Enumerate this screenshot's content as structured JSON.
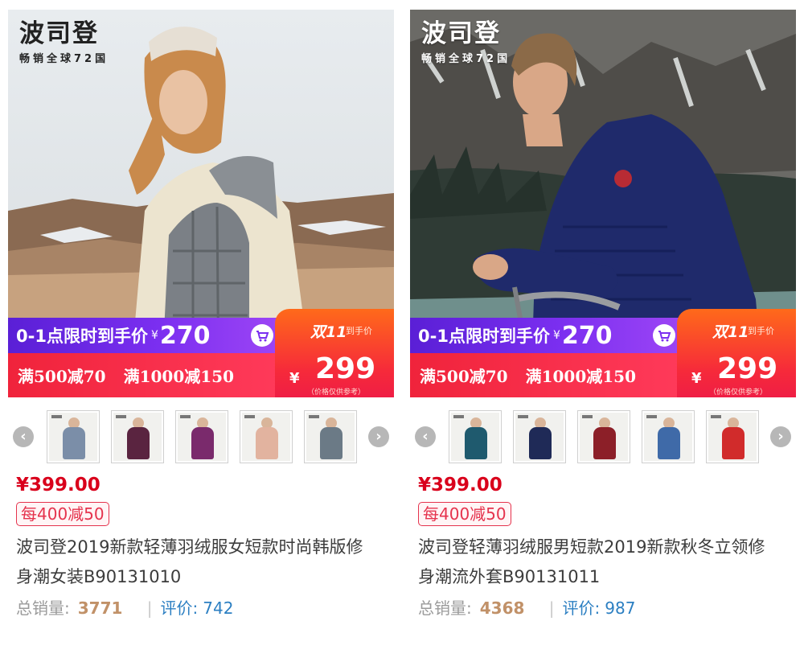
{
  "colors": {
    "price_red": "#d9001b",
    "promo_purple": "#6a28e6",
    "promo_red": "#f0233b",
    "sales_brown": "#c19168",
    "review_blue": "#2c7fc2"
  },
  "products": [
    {
      "brand": {
        "name": "波司登",
        "slogan": "畅销全球72国"
      },
      "promo": {
        "flash_label": "0-1点限时到手价",
        "flash_currency": "¥",
        "flash_price": "270",
        "coupon_1": "满500减70",
        "coupon_2": "满1000减150",
        "event_label": "双11",
        "event_sub": "到手价",
        "event_currency": "¥",
        "event_price": "299",
        "event_note": "（价格仅供参考）",
        "cart_icon": "cart-icon"
      },
      "thumbnail_colors": [
        "#7b8ea8",
        "#5a2440",
        "#7a2a6c",
        "#e2b39f",
        "#6b7a86"
      ],
      "price": "¥399.00",
      "coupon_tag": "每400减50",
      "title": "波司登2019新款轻薄羽绒服女短款时尚韩版修身潮女装B90131010",
      "sales_label": "总销量:",
      "sales_value": "3771",
      "separator": "|",
      "review_label": "评价:",
      "review_value": "742"
    },
    {
      "brand": {
        "name": "波司登",
        "slogan": "畅销全球72国"
      },
      "promo": {
        "flash_label": "0-1点限时到手价",
        "flash_currency": "¥",
        "flash_price": "270",
        "coupon_1": "满500减70",
        "coupon_2": "满1000减150",
        "event_label": "双11",
        "event_sub": "到手价",
        "event_currency": "¥",
        "event_price": "299",
        "event_note": "（价格仅供参考）",
        "cart_icon": "cart-icon"
      },
      "thumbnail_colors": [
        "#1f5a6e",
        "#1f2a57",
        "#8c1f28",
        "#3f6aa8",
        "#d12b2b"
      ],
      "price": "¥399.00",
      "coupon_tag": "每400减50",
      "title": "波司登轻薄羽绒服男短款2019新款秋冬立领修身潮流外套B90131011",
      "sales_label": "总销量:",
      "sales_value": "4368",
      "separator": "|",
      "review_label": "评价:",
      "review_value": "987"
    }
  ]
}
